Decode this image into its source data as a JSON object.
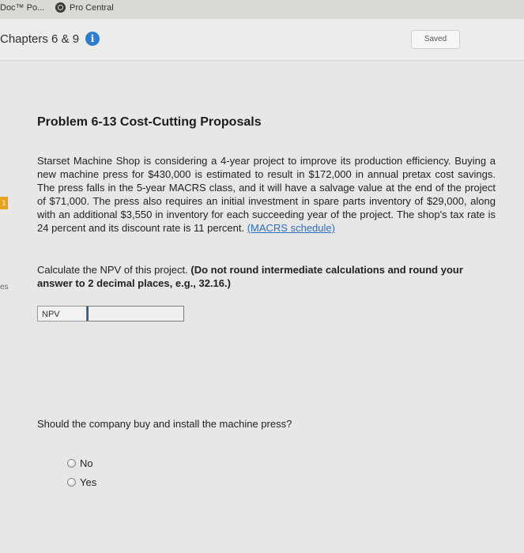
{
  "browser": {
    "tabs": [
      {
        "label": "Doc™ Po..."
      },
      {
        "label": "Pro Central"
      }
    ]
  },
  "header": {
    "title": "Chapters 6 & 9",
    "info_icon": "i",
    "saved_label": "Saved"
  },
  "sidebar": {
    "badge": "1",
    "partial_text": "es"
  },
  "problem": {
    "title": "Problem 6-13 Cost-Cutting Proposals",
    "body": "Starset Machine Shop is considering a 4-year project to improve its production efficiency. Buying a new machine press for $430,000 is estimated to result in $172,000 in annual pretax cost savings. The press falls in the 5-year MACRS class, and it will have a salvage value at the end of the project of $71,000. The press also requires an initial investment in spare parts inventory of $29,000, along with an additional $3,550 in inventory for each succeeding year of the project. The shop's tax rate is 24 percent and its discount rate is 11 percent. ",
    "link_text": "(MACRS schedule)",
    "calc_prefix": "Calculate the NPV of this project. ",
    "calc_instruction": "(Do not round intermediate calculations and round your answer to 2 decimal places, e.g., 32.16.)",
    "npv_label": "NPV",
    "npv_value": ""
  },
  "question": {
    "text": "Should the company buy and install the machine press?",
    "options": [
      {
        "label": "No"
      },
      {
        "label": "Yes"
      }
    ]
  }
}
